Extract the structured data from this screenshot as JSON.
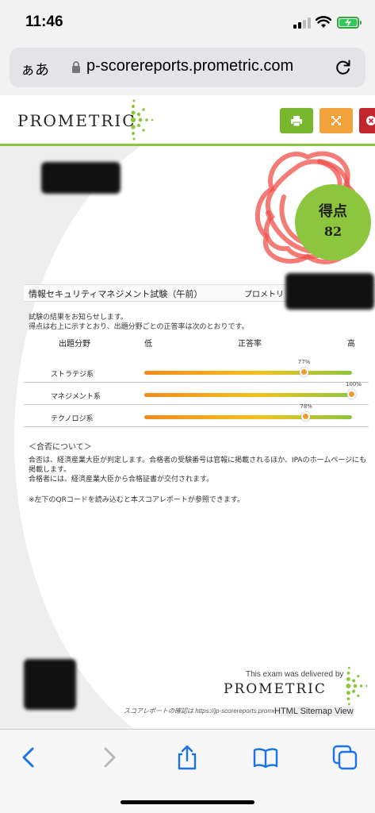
{
  "status_bar": {
    "time": "11:46"
  },
  "address_bar": {
    "aa_label": "ぁあ",
    "url": "p-scorereports.prometric.com"
  },
  "header": {
    "logo_text": "PROMETRIC",
    "print_icon": "printer-icon",
    "expand_icon": "expand-icon",
    "close_icon": "close-icon"
  },
  "score": {
    "label": "得点",
    "value": "82"
  },
  "exam": {
    "name": "情報セキュリティマネジメント試験（午前）",
    "center_label": "プロメトリ"
  },
  "notice": {
    "line1": "試験の結果をお知らせします。",
    "line2": "得点は右上に示すとおり、出題分野ごとの正答率は次のとおりです。"
  },
  "columns": {
    "field": "出題分野",
    "low": "低",
    "rate": "正答率",
    "high": "高"
  },
  "subjects": [
    {
      "name": "ストラテジ系",
      "percent_label": "77%",
      "percent": 77
    },
    {
      "name": "マネジメント系",
      "percent_label": "100%",
      "percent": 100
    },
    {
      "name": "テクノロジ系",
      "percent_label": "78%",
      "percent": 78
    }
  ],
  "about": {
    "title": "＜合否について＞",
    "line1": "合否は、経済産業大臣が判定します。合格者の受験番号は官報に掲載されるほか、IPAのホームページにも掲載します。",
    "line2": "合格者には、経済産業大臣から合格証書が交付されます。",
    "qr_note": "※左下のQRコードを読み込むと本スコアレポートが参照できます。"
  },
  "footer": {
    "delivered": "This exam was delivered by",
    "logo_text": "PROMETRIC",
    "verify_text": "スコアレポートの確認は https://jp-scorereports.prometric.com",
    "sitemap": "HTML Sitemap View"
  },
  "colors": {
    "brand_green": "#8cc63f",
    "print_button": "#77b82f",
    "expand_button": "#f2a23a",
    "close_button": "#c1272d",
    "safari_blue": "#1a73e8"
  }
}
